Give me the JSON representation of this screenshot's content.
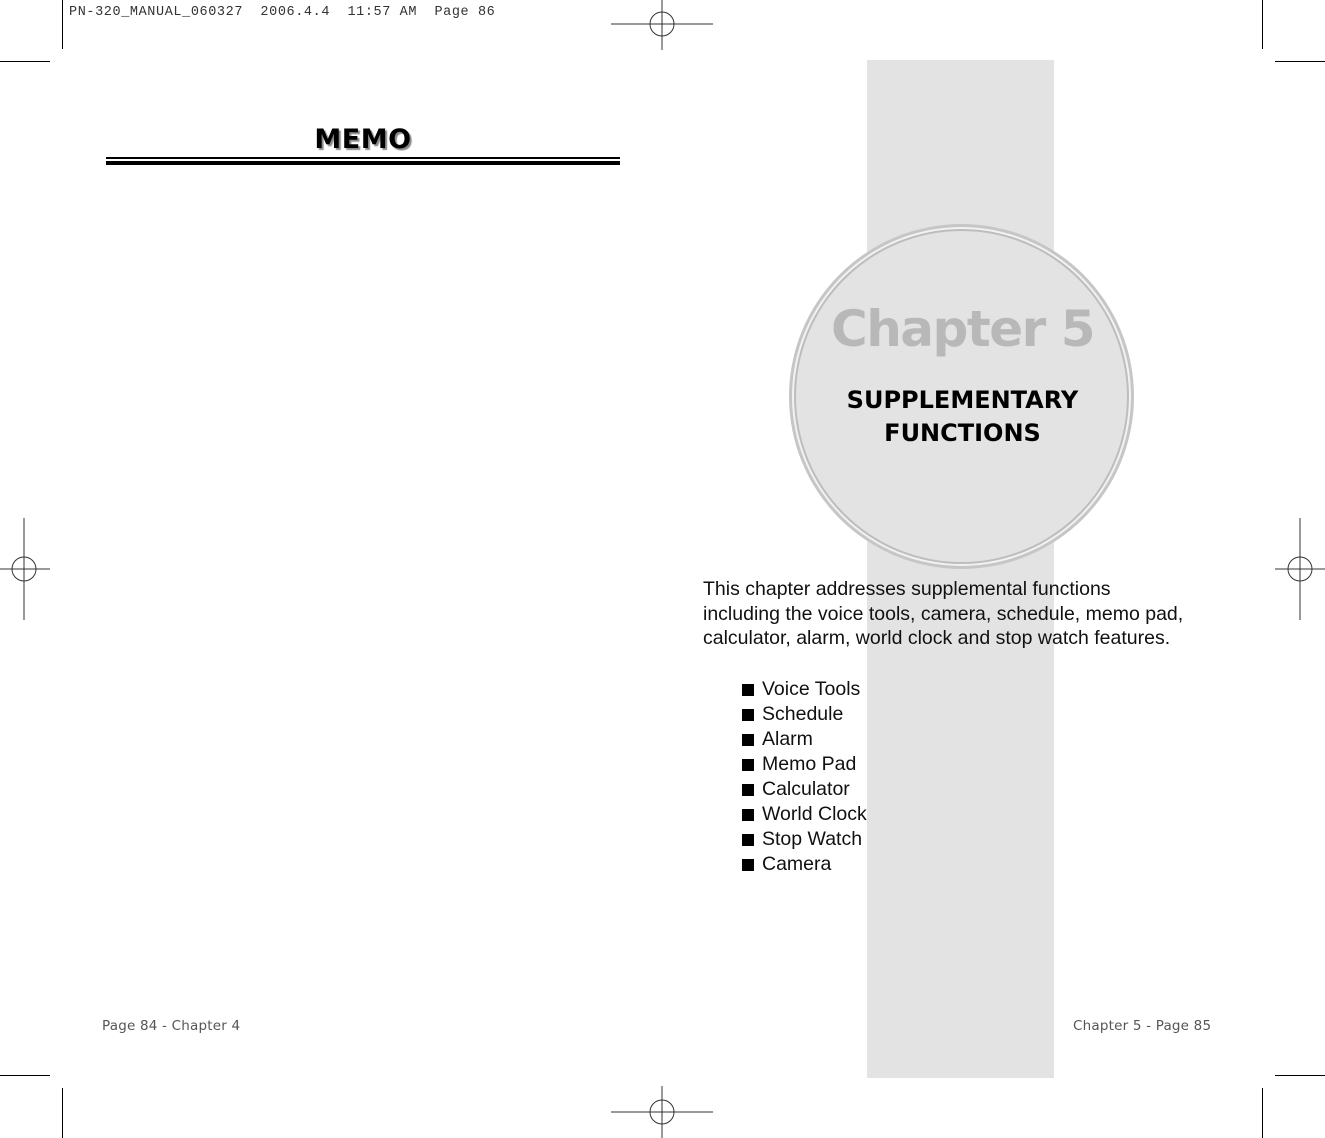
{
  "slug": {
    "text": "PN-320_MANUAL_060327  2006.4.4  11:57 AM  Page 86"
  },
  "left_page": {
    "title": "MEMO",
    "footer": "Page 84 - Chapter 4"
  },
  "right_page": {
    "chapter_label": "Chapter 5",
    "chapter_title_lines": [
      "SUPPLEMENTARY",
      "FUNCTIONS"
    ],
    "intro_lines": [
      "This chapter addresses supplemental functions",
      "including the voice tools, camera, schedule, memo pad,",
      "calculator, alarm, world clock and stop watch features."
    ],
    "features": [
      "Voice Tools",
      "Schedule",
      "Alarm",
      "Memo Pad",
      "Calculator",
      "World Clock",
      "Stop Watch",
      "Camera"
    ],
    "footer": "Chapter 5 - Page 85"
  },
  "colors": {
    "band": "#e3e3e3",
    "chapter_label": "#b8b8b8",
    "text": "#000000"
  },
  "icons": {
    "registration_mark": "crosshair-circle-icon",
    "bullet": "square-bullet-icon"
  }
}
